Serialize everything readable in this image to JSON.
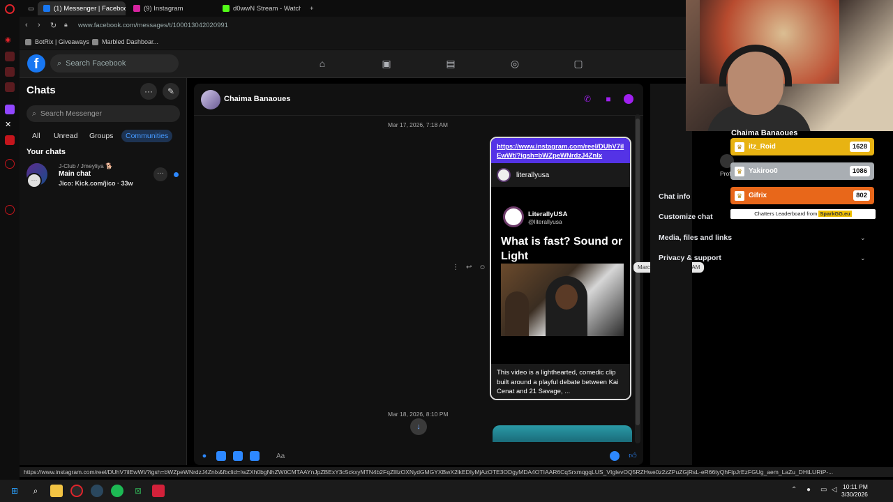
{
  "browser": {
    "tabs": [
      {
        "label": "(1) Messenger | Facebook",
        "active": true
      },
      {
        "label": "(9) Instagram",
        "active": false
      },
      {
        "label": "d0wwN Stream - Watch Li",
        "active": false
      }
    ],
    "url": "www.facebook.com/messages/t/100013042020991",
    "bookmarks": [
      "BotRix | Giveaways",
      "Marbled Dashboar..."
    ],
    "status_url": "https://www.instagram.com/reel/DUhV7ilEwWt/?igsh=bWZpeWNrdzJ4Znlx&fbclid=IwZXh0bgNhZW0CMTAAYnJpZBExY3c5ckxyMTN4b2FqZllIzOXNydGMGYXBwX2lkEDIyMjAzOTE3ODgyMDA4OTIAAR6CqSrxmqgqLUS_VIgIevOQ5RZHwe0z2zZPuZGjRsL-eR66tyQhFlpJrEzFGUg_aem_LaZu_DHtLURtP-..."
  },
  "facebook": {
    "search_placeholder": "Search Facebook"
  },
  "sidebar": {
    "title": "Chats",
    "search_placeholder": "Search Messenger",
    "filters": [
      "All",
      "Unread",
      "Groups",
      "Communities"
    ],
    "active_filter": "Communities",
    "section": "Your chats",
    "chat": {
      "group": "J-Club / Jmeyliya 🐕",
      "name": "Main chat",
      "last": "Jico: Kick.com/jico · 33w"
    }
  },
  "conversation": {
    "contact_name": "Chaima Banaoues",
    "date1": "Mar 17, 2026, 7:18 AM",
    "date2": "Mar 18, 2026, 8:10 PM",
    "link": "https://www.instagram.com/reel/DUhV7ilEwWt/?igsh=bWZpeWNrdzJ4Znlx",
    "reel_account": "literallyusa",
    "reel_poster_name": "LiterallyUSA",
    "reel_poster_handle": "@literallyusa",
    "reel_title": "What is fast? Sound or Light",
    "reel_description": "This video is a lighthearted, comedic clip built around a playful debate between Kai Cenat and 21 Savage, ...",
    "tooltip": "March 17, 2026, 7:18 AM",
    "composer_placeholder": "Aa"
  },
  "info_panel": {
    "items": [
      "Chat info",
      "Customize chat",
      "Media, files and links",
      "Privacy & support"
    ],
    "profile_label": "Prof"
  },
  "leaderboard": {
    "title": "Chaima Banaoues",
    "rows": [
      {
        "name": "itz_Roid",
        "score": "1628",
        "color": "#e8b312"
      },
      {
        "name": "Yakiroo0",
        "score": "1086",
        "color": "#a9aeb3"
      },
      {
        "name": "Gifrix",
        "score": "802",
        "color": "#e8671a"
      }
    ],
    "footer_text": "Chatters Leaderboard from",
    "footer_brand": "SparkGG.eu"
  },
  "taskbar": {
    "time": "10:11 PM",
    "date": "3/30/2026"
  }
}
